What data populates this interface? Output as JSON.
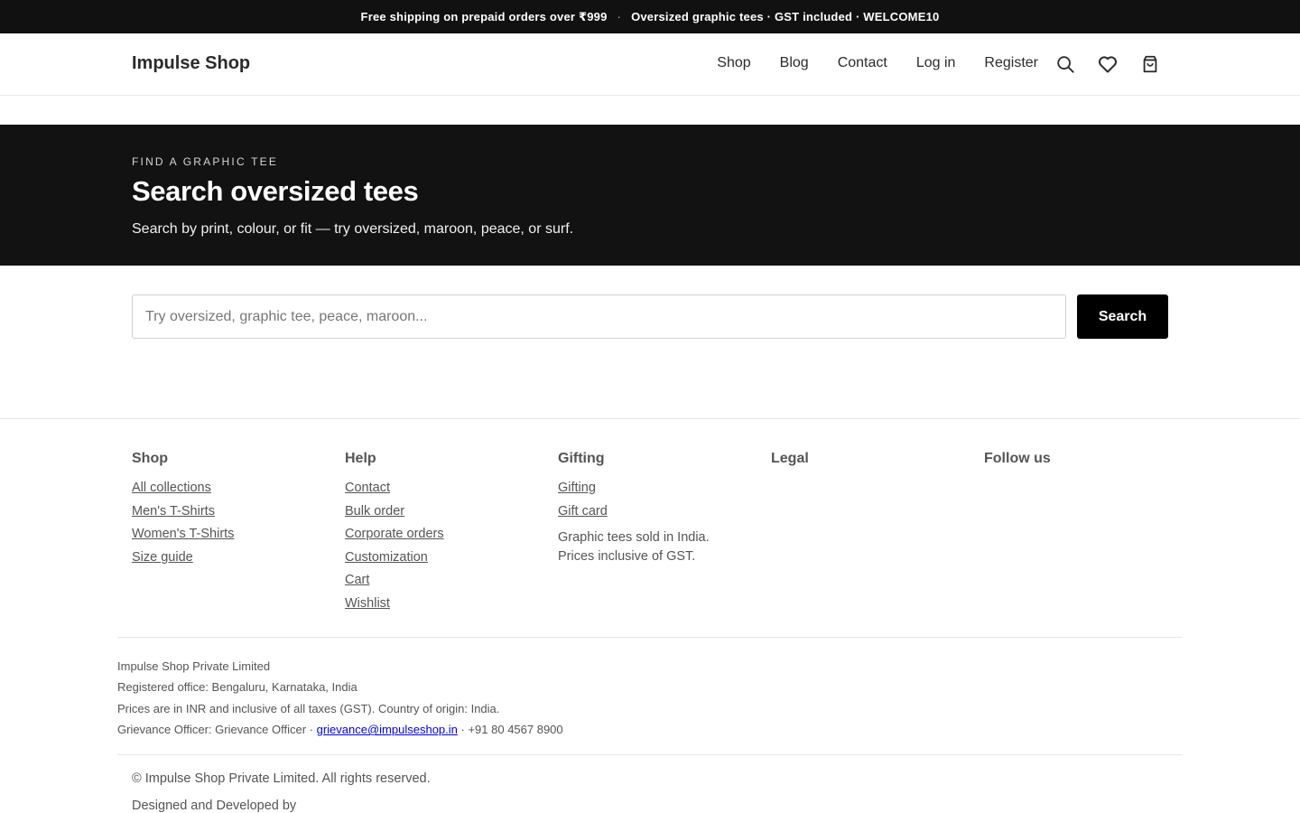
{
  "announcement": {
    "left": "Free shipping on prepaid orders over ₹999",
    "separator": "·",
    "right": "Oversized graphic tees · GST included · WELCOME10"
  },
  "header": {
    "logo": "Impulse Shop",
    "nav": [
      "Shop",
      "Blog",
      "Contact",
      "Log in",
      "Register"
    ],
    "icons": [
      "search-icon",
      "heart-icon",
      "shopping-bag-icon"
    ]
  },
  "hero": {
    "eyebrow": "FIND A GRAPHIC TEE",
    "title": "Search oversized tees",
    "subtitle": "Search by print, colour, or fit — try oversized, maroon, peace, or surf."
  },
  "search": {
    "placeholder": "Try oversized, graphic tee, peace, maroon...",
    "value": "",
    "button_label": "Search"
  },
  "footer": {
    "shop": {
      "heading": "Shop",
      "links": [
        "All collections",
        "Men's T-Shirts",
        "Women's T-Shirts",
        "Size guide"
      ]
    },
    "help": {
      "heading": "Help",
      "links": [
        "Contact",
        "Bulk order",
        "Corporate orders",
        "Customization",
        "Cart",
        "Wishlist"
      ]
    },
    "gifting": {
      "heading": "Gifting",
      "links": [
        "Gifting",
        "Gift card"
      ],
      "note_line1": "Graphic tees sold in India.",
      "note_line2": "Prices inclusive of GST."
    },
    "legal": {
      "heading": "Legal"
    },
    "follow": {
      "heading": "Follow us"
    },
    "company": {
      "name": "Impulse Shop Private Limited",
      "office": "Registered office: Bengaluru, Karnataka, India",
      "prices": "Prices are in INR and inclusive of all taxes (GST). Country of origin: India.",
      "grievance_prefix": "Grievance Officer: Grievance Officer ·",
      "grievance_email": "grievance@impulseshop.in",
      "grievance_phone": "· +91 80 4567 8900"
    },
    "copyright": "© Impulse Shop Private Limited. All rights reserved.",
    "designed_by": "Designed and Developed by"
  },
  "colors": {
    "announcement_bg": "#111111",
    "hero_bg": "#121212",
    "button_bg": "#000000",
    "footer_text": "#555555",
    "link_blue": "#0000ee"
  }
}
